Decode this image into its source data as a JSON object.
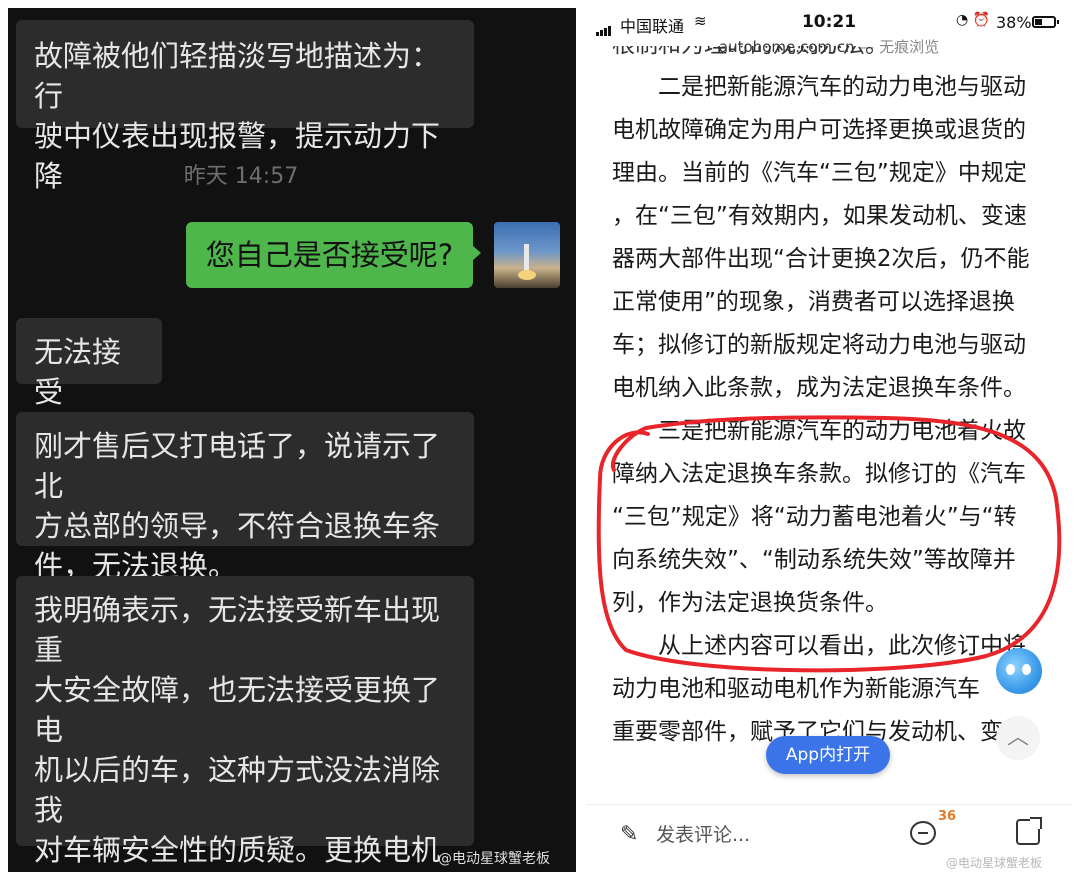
{
  "chat": {
    "msg1": "故障被他们轻描淡写地描述为：行\n驶中仪表出现报警，提示动力下降",
    "timestamp": "昨天 14:57",
    "msg2": "您自己是否接受呢?",
    "msg3": "无法接受",
    "msg4": "刚才售后又打电话了，说请示了北\n方总部的领导，不符合退换车条\n件，无法退换。",
    "msg5": "我明确表示，无法接受新车出现重\n大安全故障，也无法接受更换了电\n机以后的车，这种方式没法消除我\n对车辆安全性的质疑。更换电机会\n让这辆车迅速贬值，成为一辆“事\n故车”，让我承担了不该承受的损\n失。",
    "watermark": "@电动星球蟹老板"
  },
  "phone": {
    "carrier": "中国联通",
    "time": "10:21",
    "battery": "38%",
    "battery_level": 0.38,
    "url": "autohome.com.cn",
    "browse_mode": " — 无痕浏览",
    "article_top_cut": "根制和为理时的规则办法。",
    "article_lines": [
      "　　二是把新能源汽车的动力电池与驱动",
      "电机故障确定为用户可选择更换或退货的",
      "理由。当前的《汽车“三包”规定》中规定",
      "，在“三包”有效期内，如果发动机、变速",
      "器两大部件出现“合计更换2次后，仍不能",
      "正常使用”的现象，消费者可以选择退换",
      "车；拟修订的新版规定将动力电池与驱动",
      "电机纳入此条款，成为法定退换车条件。",
      "　　三是把新能源汽车的动力电池着火故",
      "障纳入法定退换车条款。拟修订的《汽车",
      "“三包”规定》将“动力蓄电池着火”与“转",
      "向系统失效”、“制动系统失效”等故障并",
      "列，作为法定退换货条件。",
      "　　从上述内容可以看出，此次修订中将",
      "动力电池和驱动电机作为新能源汽车",
      "重要零部件，赋予了它们与发动机、变速"
    ],
    "open_in_app": "App内打开",
    "comment_placeholder": "发表评论...",
    "comment_count": "36",
    "watermark": "@电动星球蟹老板",
    "highlight_color": "#e8252b"
  }
}
